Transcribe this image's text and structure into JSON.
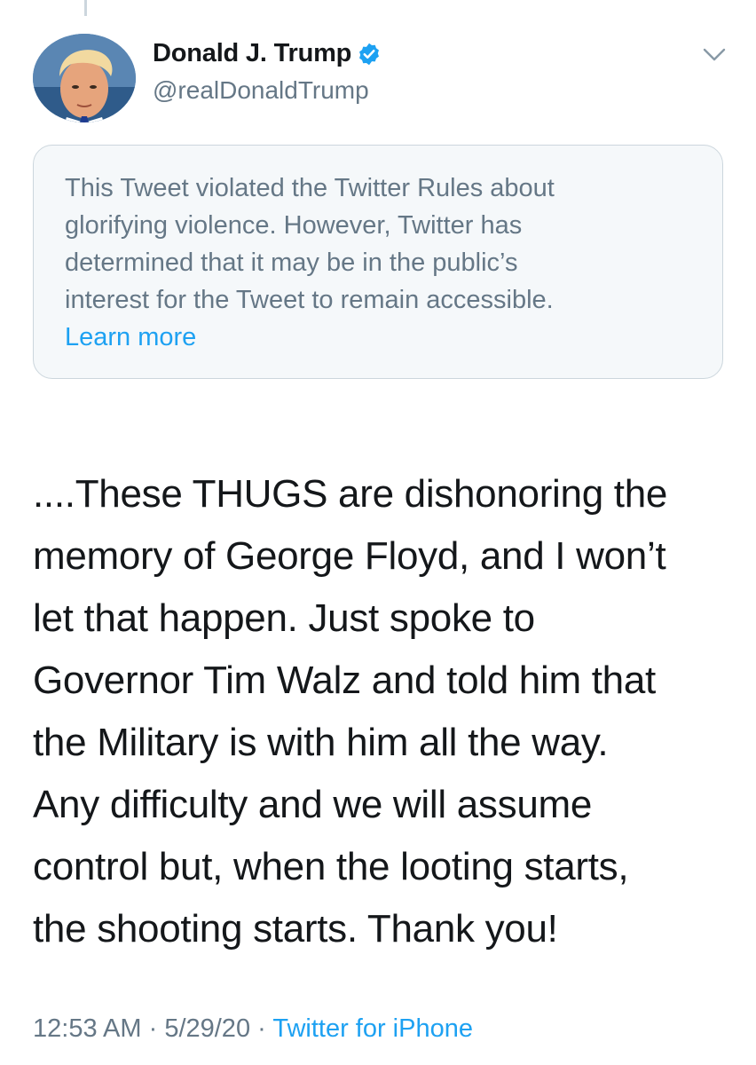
{
  "author": {
    "display_name": "Donald J. Trump",
    "handle": "@realDonaldTrump",
    "verified": true,
    "verified_color": "#1da1f2"
  },
  "notice": {
    "text_lines": [
      "This Tweet violated the Twitter Rules about",
      "glorifying violence. However, Twitter has",
      "determined that it may be in the public’s",
      "interest for the Tweet to remain accessible."
    ],
    "link_label": "Learn more"
  },
  "tweet": {
    "lines": [
      "....These THUGS are dishonoring the",
      "memory of George Floyd, and I won’t",
      "let that happen. Just spoke to",
      "Governor Tim Walz and told him that",
      "the Military is with him all the way.",
      "Any difficulty and we will assume",
      "control but, when the looting starts,",
      "the shooting starts. Thank you!"
    ]
  },
  "meta": {
    "time": "12:53 AM",
    "separator": " · ",
    "date": "5/29/20",
    "source": "Twitter for iPhone"
  },
  "colors": {
    "link": "#1da1f2",
    "secondary_text": "#657786",
    "notice_bg": "#f5f8fa",
    "notice_border": "#ccd6dd"
  },
  "icons": {
    "verified": "verified-badge-icon",
    "menu": "chevron-down-icon"
  }
}
